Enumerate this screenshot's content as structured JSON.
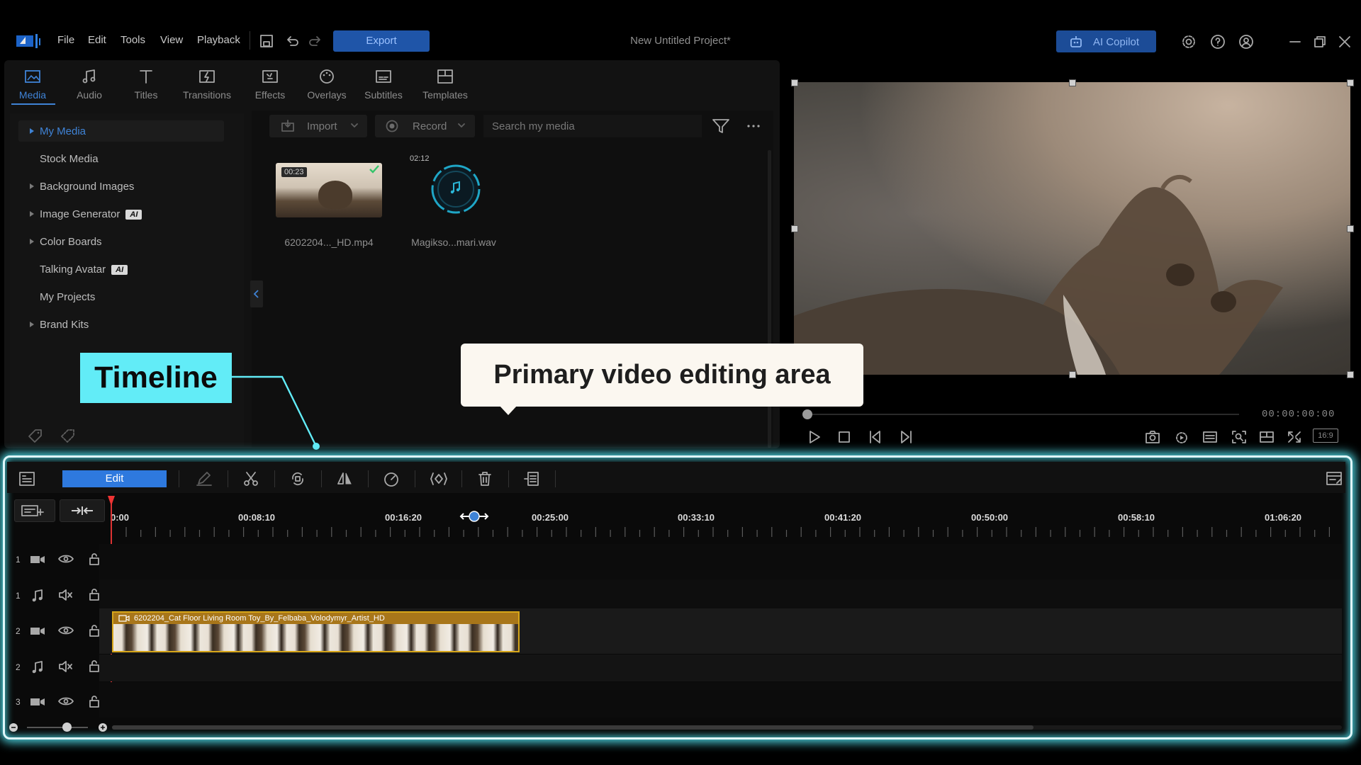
{
  "app": {
    "menu": [
      "File",
      "Edit",
      "Tools",
      "View",
      "Playback"
    ],
    "export_label": "Export",
    "project_title": "New Untitled Project*",
    "copilot_label": "AI Copilot"
  },
  "library": {
    "tabs": [
      "Media",
      "Audio",
      "Titles",
      "Transitions",
      "Effects",
      "Overlays",
      "Subtitles",
      "Templates"
    ],
    "active_tab": "Media",
    "sidebar": [
      "My Media",
      "Stock Media",
      "Background Images",
      "Image Generator",
      "Color Boards",
      "Talking Avatar",
      "My Projects",
      "Brand Kits"
    ],
    "ai_badge": "AI",
    "import_label": "Import",
    "record_label": "Record",
    "search_placeholder": "Search my media",
    "items": [
      {
        "duration": "00:23",
        "name": "6202204..._HD.mp4"
      },
      {
        "duration": "02:12",
        "name": "Magikso...mari.wav"
      }
    ]
  },
  "preview": {
    "timecode": "00:00:00:00",
    "aspect": "16:9"
  },
  "callouts": {
    "timeline": "Timeline",
    "primary": "Primary video editing area"
  },
  "timeline": {
    "edit_label": "Edit",
    "ruler": [
      "0:00",
      "00:08:10",
      "00:16:20",
      "00:25:00",
      "00:33:10",
      "00:41:20",
      "00:50:00",
      "00:58:10",
      "01:06:20"
    ],
    "tracks": [
      {
        "num": "1",
        "kind": "video"
      },
      {
        "num": "1",
        "kind": "audio"
      },
      {
        "num": "2",
        "kind": "video"
      },
      {
        "num": "2",
        "kind": "audio"
      },
      {
        "num": "3",
        "kind": "video"
      }
    ],
    "clip_title": "6202204_Cat Floor Living Room Toy_By_Felbaba_Volodymyr_Artist_HD"
  },
  "colors": {
    "accent": "#2e79de",
    "highlight_glow": "#4fd6e2",
    "clip_border": "#d7a619"
  }
}
